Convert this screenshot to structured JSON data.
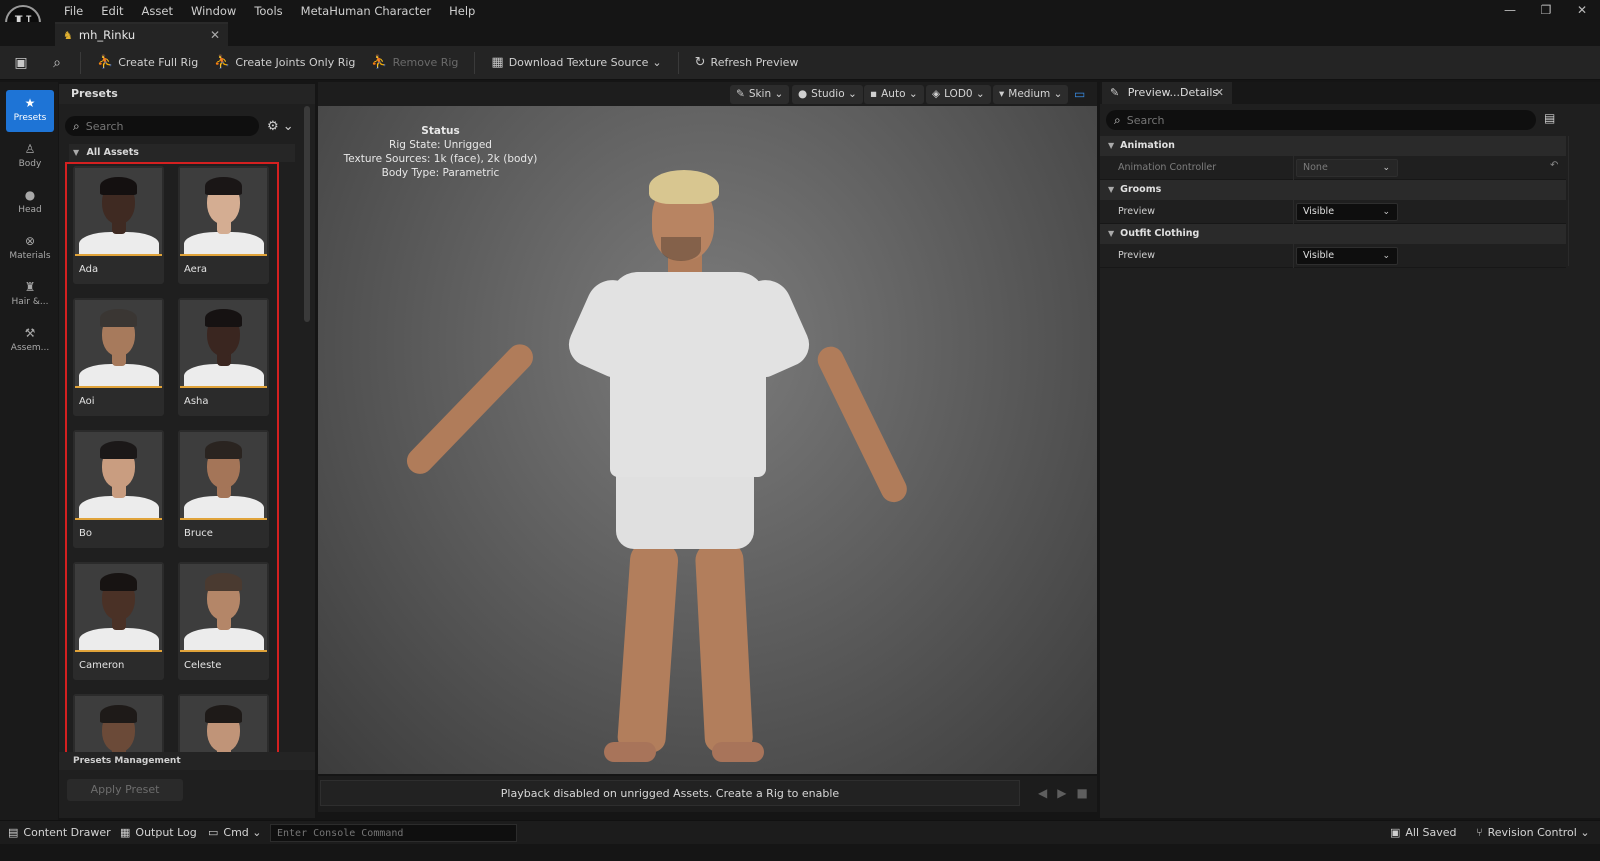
{
  "menu": {
    "logo_label": "U",
    "items": [
      "File",
      "Edit",
      "Asset",
      "Window",
      "Tools",
      "MetaHuman Character",
      "Help"
    ],
    "window_controls": [
      "—",
      "❐",
      "✕"
    ]
  },
  "document_tab": {
    "label": "mh_Rinku",
    "close": "✕"
  },
  "toolbar": {
    "save_icon": "save-icon",
    "browse_icon": "browse-icon",
    "create_full_rig": "Create Full Rig",
    "create_joints_only_rig": "Create Joints Only Rig",
    "remove_rig": "Remove Rig",
    "download_texture_source": "Download Texture Source",
    "download_chevron": "⌄",
    "refresh_preview": "Refresh Preview"
  },
  "vtabs": [
    {
      "label": "Presets",
      "active": true
    },
    {
      "label": "Body",
      "active": false
    },
    {
      "label": "Head",
      "active": false
    },
    {
      "label": "Materials",
      "active": false
    },
    {
      "label": "Hair &...",
      "active": false
    },
    {
      "label": "Assem...",
      "active": false
    }
  ],
  "presets": {
    "title": "Presets",
    "search_placeholder": "Search",
    "all_assets": "All Assets",
    "items": [
      {
        "name": "Ada",
        "skin": "#3f2a22",
        "hair": "#141010"
      },
      {
        "name": "Aera",
        "skin": "#d4ad92",
        "hair": "#1a1616"
      },
      {
        "name": "Aoi",
        "skin": "#a77a5c",
        "hair": "#3a3633"
      },
      {
        "name": "Asha",
        "skin": "#3a2620",
        "hair": "#161212"
      },
      {
        "name": "Bo",
        "skin": "#c99d80",
        "hair": "#1b1818"
      },
      {
        "name": "Bruce",
        "skin": "#a47558",
        "hair": "#2a2420"
      },
      {
        "name": "Cameron",
        "skin": "#4a3126",
        "hair": "#171312"
      },
      {
        "name": "Celeste",
        "skin": "#b48668",
        "hair": "#4a3a30"
      },
      {
        "name": "",
        "skin": "#6b4a38",
        "hair": "#1e1a18"
      },
      {
        "name": "",
        "skin": "#c09478",
        "hair": "#1e1a18"
      }
    ],
    "management": "Presets Management",
    "apply_preset": "Apply Preset"
  },
  "viewport": {
    "buttons": [
      {
        "label": "Skin",
        "icon": "✎"
      },
      {
        "label": "Studio",
        "icon": "●"
      },
      {
        "label": "Auto",
        "icon": "▪"
      },
      {
        "label": "LOD0",
        "icon": "◈"
      },
      {
        "label": "Medium",
        "icon": "▾"
      }
    ],
    "status": {
      "title": "Status",
      "rig_state": "Rig State: Unrigged",
      "texture_sources": "Texture Sources: 1k (face), 2k (body)",
      "body_type": "Body Type: Parametric"
    },
    "playback_message": "Playback disabled on unrigged Assets. Create a Rig to enable"
  },
  "details": {
    "tab_label": "Preview...Details",
    "search_placeholder": "Search",
    "sections": [
      {
        "title": "Animation",
        "prop_label": "Animation Controller",
        "prop_value": "None"
      },
      {
        "title": "Grooms",
        "prop_label": "Preview",
        "prop_value": "Visible"
      },
      {
        "title": "Outfit Clothing",
        "prop_label": "Preview",
        "prop_value": "Visible"
      }
    ]
  },
  "statusbar": {
    "content_drawer": "Content Drawer",
    "output_log": "Output Log",
    "cmd": "Cmd",
    "console_placeholder": "Enter Console Command",
    "all_saved": "All Saved",
    "revision_control": "Revision Control"
  }
}
